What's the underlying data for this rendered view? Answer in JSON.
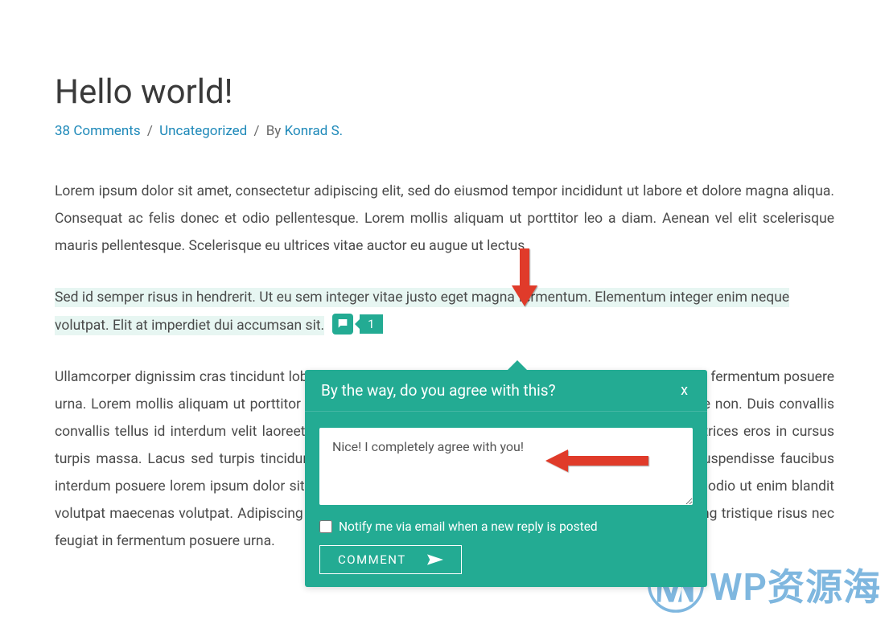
{
  "post": {
    "title": "Hello world!",
    "comments_link": "38 Comments",
    "category": "Uncategorized",
    "by_text": "By",
    "author": "Konrad S."
  },
  "paragraphs": {
    "p1": "Lorem ipsum dolor sit amet, consectetur adipiscing elit, sed do eiusmod tempor incididunt ut labore et dolore magna aliqua. Consequat ac felis donec et odio pellentesque. Lorem mollis aliquam ut porttitor leo a diam. Aenean vel elit scelerisque mauris pellentesque. Scelerisque eu ultrices vitae auctor eu augue ut lectus.",
    "p2": "Sed id semper risus in hendrerit. Ut eu sem integer vitae justo eget magna fermentum. Elementum integer enim neque volutpat. Elit at imperdiet dui accumsan sit.",
    "p3": "Ullamcorper dignissim cras tincidunt lobortis feugiat vivamus at. Adipiscing tristique risus nec feugiat in fermentum posuere urna. Lorem mollis aliquam ut porttitor leo a porttitor. Semper risus in hendrerit gravida rutrum quisque non. Duis convallis convallis tellus id interdum velit laoreet id. Sit amet volutpat sed. Orci eu lobortis elementum nibh. Ultrices eros in cursus turpis massa. Lacus sed turpis tincidunt id aliquet risus feugiat. Sed id semper risus. Quam lacus suspendisse faucibus interdum posuere lorem ipsum dolor sit amet. Condimentum lacinia quis vel eros donec. Sed vulputate odio ut enim blandit volutpat maecenas volutpat. Adipiscing tristique risus nec feugiat in fermentum posuere urna. Adipiscing tristique risus nec feugiat in fermentum posuere urna."
  },
  "inline_comment": {
    "count": "1"
  },
  "popup": {
    "prompt": "By the way, do you agree with this?",
    "close": "x",
    "textarea_value": "Nice! I completely agree with you!",
    "notify_label": "Notify me via email when a new reply is posted",
    "submit_label": "COMMENT"
  },
  "watermark": {
    "text": "WP资源海"
  }
}
